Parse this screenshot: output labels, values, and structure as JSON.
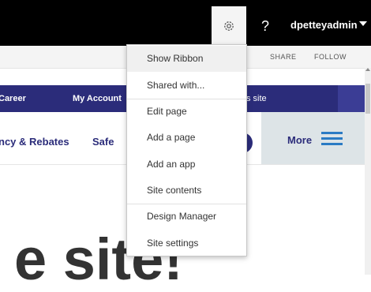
{
  "suite_bar": {
    "help_label": "?",
    "user_name": "dpetteyadmin",
    "icons": [
      "gear-icon",
      "chevron-down-icon"
    ]
  },
  "ribbon": {
    "share_label": "SHARE",
    "follow_label": "FOLLOW"
  },
  "top_nav": {
    "items": [
      "Career",
      "My Account",
      "s site"
    ]
  },
  "secondary_nav": {
    "items": [
      "ncy & Rebates",
      "Safe"
    ],
    "more_label": "More",
    "icons": [
      "hamburger-icon"
    ]
  },
  "hero": {
    "text": "e site!"
  },
  "settings_menu": {
    "items": [
      {
        "label": "Show Ribbon",
        "highlighted": true
      },
      {
        "label": "Shared with..."
      },
      {
        "label": "Edit page"
      },
      {
        "label": "Add a page"
      },
      {
        "label": "Add an app"
      },
      {
        "label": "Site contents"
      },
      {
        "label": "Design Manager"
      },
      {
        "label": "Site settings"
      }
    ]
  },
  "colors": {
    "suite_bar": "#000000",
    "nav_blue": "#2b2c7a",
    "more_panel": "#dde4e7",
    "hamburger": "#2b7bc4"
  }
}
